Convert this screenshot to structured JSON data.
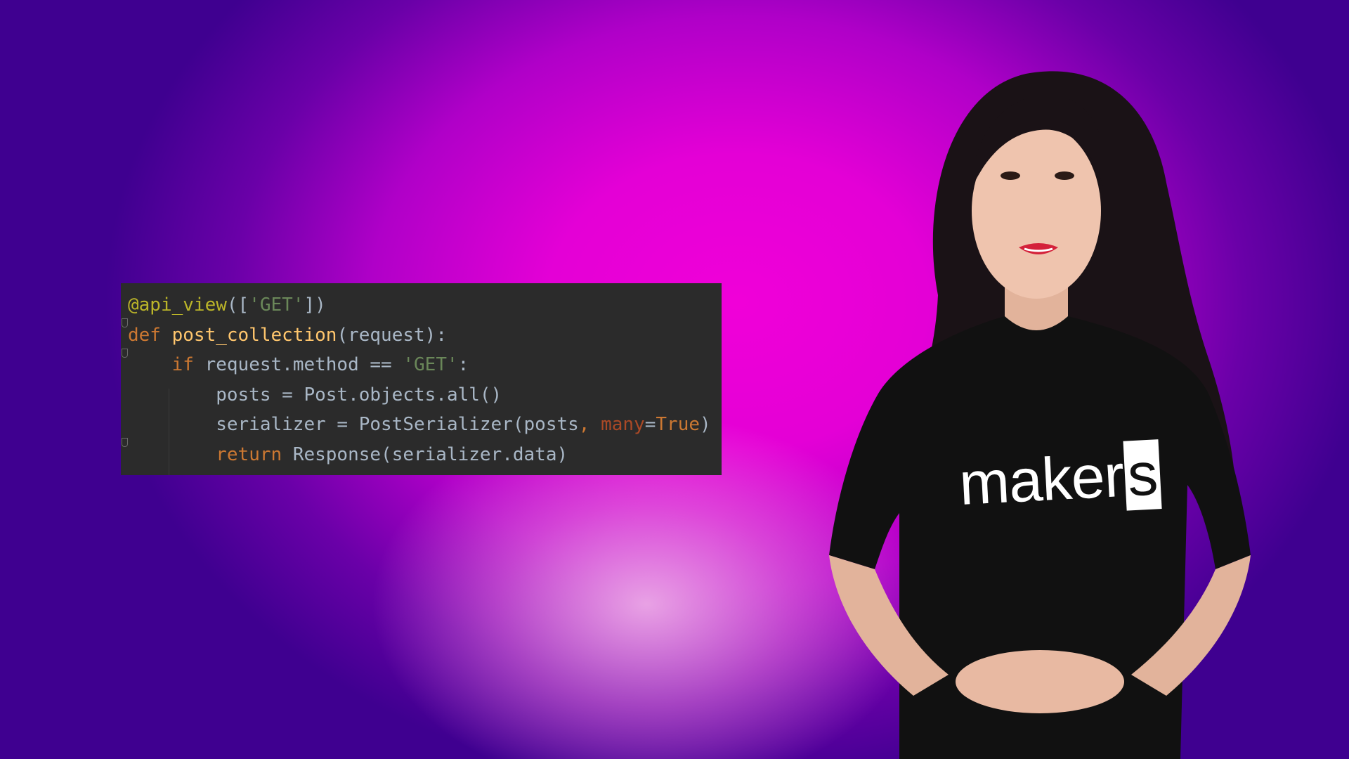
{
  "code_snippet": {
    "language": "python",
    "lines": [
      [
        {
          "text": "@api_view",
          "type": "decorator"
        },
        {
          "text": "([",
          "type": "plain"
        },
        {
          "text": "'GET'",
          "type": "string"
        },
        {
          "text": "])",
          "type": "plain"
        }
      ],
      [
        {
          "text": "def ",
          "type": "keyword"
        },
        {
          "text": "post_collection",
          "type": "func"
        },
        {
          "text": "(request):",
          "type": "plain"
        }
      ],
      [
        {
          "text": "    ",
          "type": "plain"
        },
        {
          "text": "if ",
          "type": "keyword"
        },
        {
          "text": "request.method == ",
          "type": "plain"
        },
        {
          "text": "'GET'",
          "type": "string"
        },
        {
          "text": ":",
          "type": "plain"
        }
      ],
      [
        {
          "text": "        posts = Post.objects.all()",
          "type": "plain"
        }
      ],
      [
        {
          "text": "        serializer = PostSerializer(posts",
          "type": "plain"
        },
        {
          "text": ", ",
          "type": "keyword"
        },
        {
          "text": "many",
          "type": "param"
        },
        {
          "text": "=",
          "type": "plain"
        },
        {
          "text": "True",
          "type": "keyword"
        },
        {
          "text": ")",
          "type": "plain"
        }
      ],
      [
        {
          "text": "        ",
          "type": "plain"
        },
        {
          "text": "return ",
          "type": "keyword"
        },
        {
          "text": "Response(serializer.data)",
          "type": "plain"
        }
      ]
    ]
  },
  "presenter": {
    "shirt_text_main": "maker",
    "shirt_text_boxed": "s"
  },
  "colors": {
    "background_center": "#f000d8",
    "background_edge": "#3f0090",
    "code_background": "#2b2b2b",
    "shirt": "#111111"
  }
}
